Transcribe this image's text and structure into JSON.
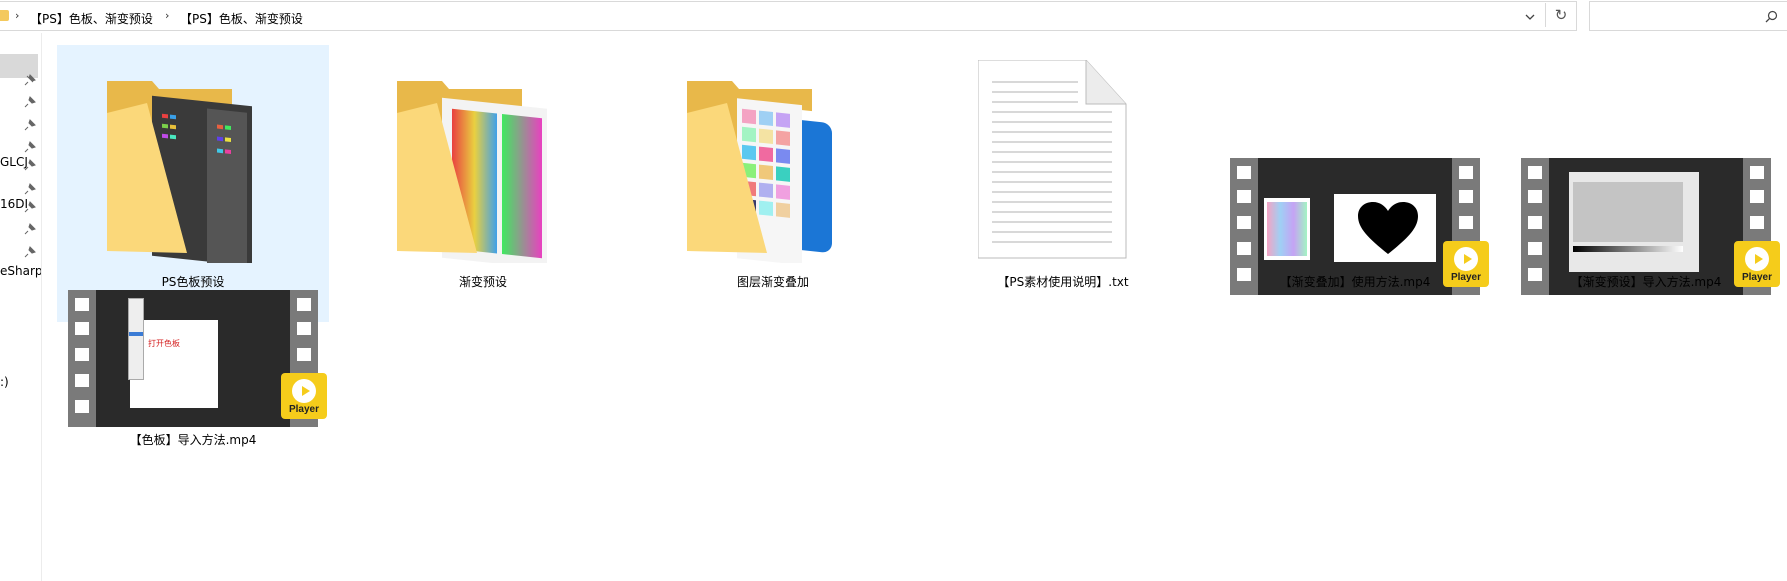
{
  "address_bar": {
    "crumbs": [
      "【PS】色板、渐变预设",
      "【PS】色板、渐变预设"
    ],
    "separator": "›",
    "refresh_icon": "↻"
  },
  "search": {
    "placeholder": ""
  },
  "nav_pane": {
    "items": [
      {
        "label": "",
        "pinned": true
      },
      {
        "label": "",
        "pinned": true
      },
      {
        "label": "",
        "pinned": true
      },
      {
        "label": "GLCJ",
        "pinned": true
      },
      {
        "label": "16DI",
        "pinned": true
      },
      {
        "label": "",
        "pinned": true
      },
      {
        "label": "",
        "pinned": true
      },
      {
        "label": "eSharp",
        "pinned": false
      },
      {
        "label": ":)",
        "pinned": false
      }
    ]
  },
  "files": [
    {
      "name": "PS色板预设",
      "type": "folder",
      "selected": true
    },
    {
      "name": "渐变预设",
      "type": "folder",
      "selected": false
    },
    {
      "name": "图层渐变叠加",
      "type": "folder",
      "selected": false
    },
    {
      "name": "【PS素材使用说明】.txt",
      "type": "text",
      "selected": false
    },
    {
      "name": "【渐变叠加】使用方法.mp4",
      "type": "video",
      "selected": false,
      "overlay_text": ""
    },
    {
      "name": "【渐变预设】导入方法.mp4",
      "type": "video",
      "selected": false,
      "overlay_text": ""
    },
    {
      "name": "【色板】导入方法.mp4",
      "type": "video",
      "selected": false,
      "overlay_text": "打开色板"
    }
  ],
  "player_badge": "Player",
  "colors": {
    "folder": "#f4c95d",
    "selection": "#e5f3ff",
    "player": "#f5cc1b"
  }
}
